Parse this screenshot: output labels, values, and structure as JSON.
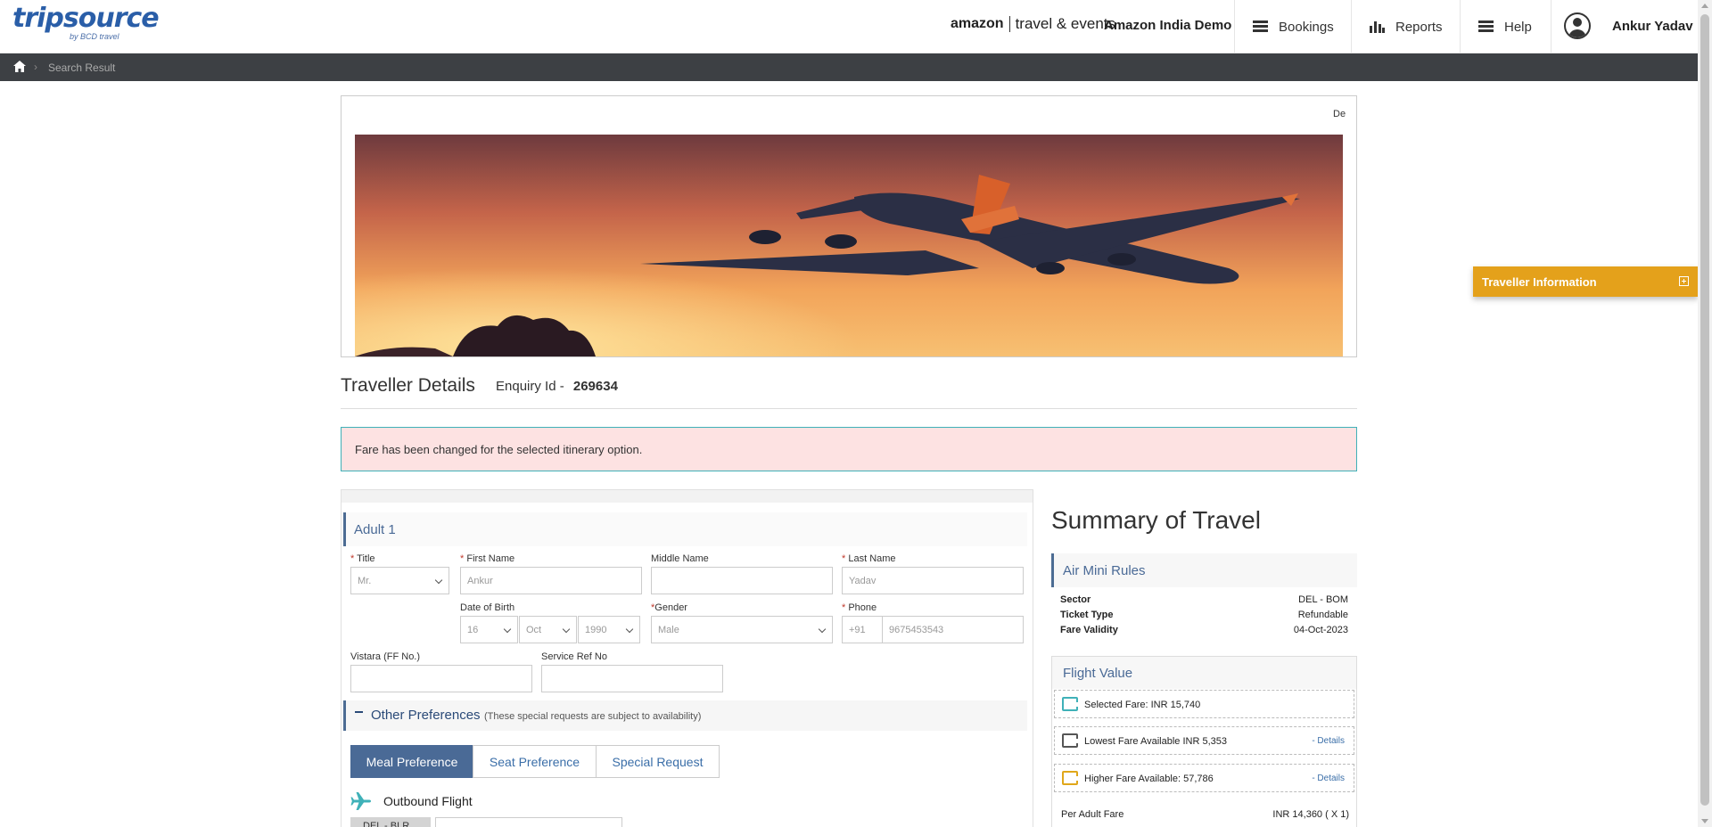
{
  "header": {
    "logo_text": "tripsource",
    "logo_sub": "by BCD travel",
    "brand_amazon": "amazon",
    "brand_rest": "travel & events",
    "company": "Amazon India Demo",
    "nav": [
      {
        "label": "Bookings",
        "icon": "menu-icon"
      },
      {
        "label": "Reports",
        "icon": "bar-chart-icon"
      },
      {
        "label": "Help",
        "icon": "menu-icon"
      }
    ],
    "user_name": "Ankur Yadav"
  },
  "breadcrumb": {
    "current": "Search Result"
  },
  "banner": {
    "peek_text": "De"
  },
  "traveller": {
    "title": "Traveller Details",
    "enquiry_label": "Enquiry Id -",
    "enquiry_id": "269634"
  },
  "alert": {
    "message": "Fare has been changed for the selected itinerary option."
  },
  "form": {
    "adult_heading": "Adult 1",
    "title_label": "Title",
    "title_value": "Mr.",
    "first_name_label": "First Name",
    "first_name_value": "Ankur",
    "middle_name_label": "Middle Name",
    "middle_name_value": "",
    "last_name_label": "Last Name",
    "last_name_value": "Yadav",
    "dob_label": "Date of Birth",
    "dob_day": "16",
    "dob_month": "Oct",
    "dob_year": "1990",
    "gender_label": "Gender",
    "gender_value": "Male",
    "phone_label": "Phone",
    "phone_code": "+91",
    "phone_value": "9675453543",
    "ff_label": "Vistara (FF No.)",
    "ff_value": "",
    "service_ref_label": "Service Ref No",
    "service_ref_value": "",
    "required_mark": "*"
  },
  "preferences": {
    "title": "Other Preferences",
    "note": "(These special requests are subject to availability)",
    "tabs": [
      {
        "label": "Meal Preference",
        "active": true
      },
      {
        "label": "Seat Preference",
        "active": false
      },
      {
        "label": "Special Request",
        "active": false
      }
    ],
    "outbound_label": "Outbound Flight",
    "segment_tag": "DEL - BLR"
  },
  "summary": {
    "title": "Summary of Travel",
    "rules_heading": "Air Mini Rules",
    "rules": [
      {
        "key": "Sector",
        "value": "DEL - BOM"
      },
      {
        "key": "Ticket Type",
        "value": "Refundable"
      },
      {
        "key": "Fare Validity",
        "value": "04-Oct-2023"
      }
    ],
    "flight_value_heading": "Flight Value",
    "fares": [
      {
        "text": "Selected Fare: INR 15,740",
        "details": ""
      },
      {
        "text": "Lowest Fare Available INR 5,353",
        "details": "- Details"
      },
      {
        "text": "Higher Fare Available: 57,786",
        "details": "- Details"
      }
    ],
    "per_adult_label": "Per Adult Fare",
    "per_adult_value": "INR 14,360 ( X 1)"
  },
  "floating": {
    "traveller_info": "Traveller Information"
  },
  "colors": {
    "breadcrumb_bg": "#3d4044",
    "accent_blue": "#4a6a96",
    "alert_bg": "#fde2e2",
    "alert_border": "#3fb1b8",
    "floating_bg": "#e4a11b"
  }
}
